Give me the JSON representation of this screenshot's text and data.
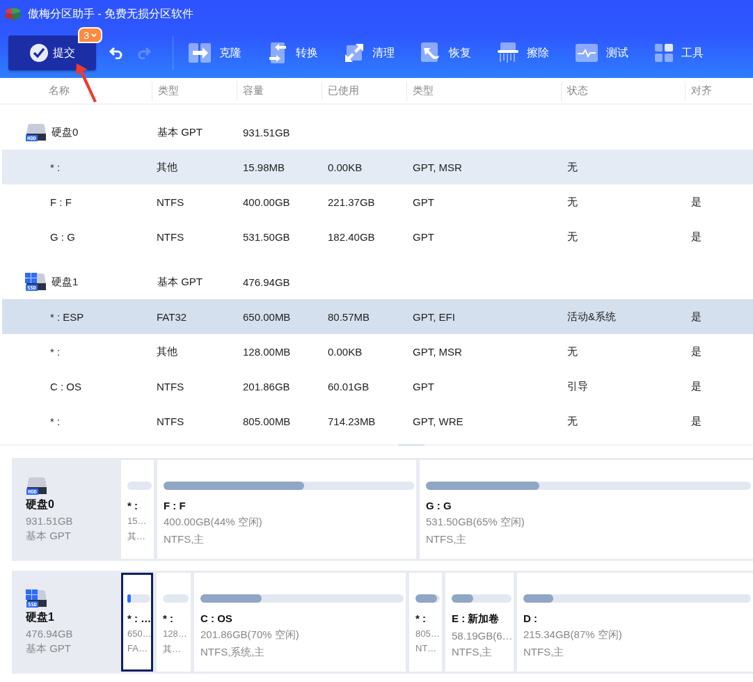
{
  "window": {
    "title": "傲梅分区助手 - 免费无损分区软件"
  },
  "toolbar": {
    "submit": {
      "label": "提交",
      "badge": "3"
    },
    "undo": {
      "disabled": false
    },
    "redo": {
      "disabled": true
    },
    "tools": [
      {
        "kind": "clone",
        "label": "克隆"
      },
      {
        "kind": "convert",
        "label": "转换"
      },
      {
        "kind": "clean",
        "label": "清理"
      },
      {
        "kind": "recover",
        "label": "恢复"
      },
      {
        "kind": "wipe",
        "label": "擦除"
      },
      {
        "kind": "test",
        "label": "测试"
      },
      {
        "kind": "tools",
        "label": "工具"
      }
    ]
  },
  "table": {
    "columns": [
      "名称",
      "类型",
      "容量",
      "已使用",
      "类型",
      "状态",
      "对齐"
    ],
    "disks": [
      {
        "name": "硬盘0",
        "kind": "hdd",
        "icon_label": "HDD",
        "type": "基本 GPT",
        "capacity": "931.51GB",
        "partitions": [
          {
            "name": "* :",
            "type": "其他",
            "capacity": "15.98MB",
            "used": "0.00KB",
            "type2": "GPT, MSR",
            "status": "无",
            "selected": false,
            "hovered": true
          },
          {
            "name": "F : F",
            "type": "NTFS",
            "capacity": "400.00GB",
            "used": "221.37GB",
            "type2": "GPT",
            "status": "无",
            "align": "是",
            "selected": false,
            "hovered": false
          },
          {
            "name": "G : G",
            "type": "NTFS",
            "capacity": "531.50GB",
            "used": "182.40GB",
            "type2": "GPT",
            "status": "无",
            "align": "是",
            "selected": false,
            "hovered": false
          }
        ]
      },
      {
        "name": "硬盘1",
        "kind": "ssd",
        "icon_label": "SSD",
        "type": "基本 GPT",
        "capacity": "476.94GB",
        "partitions": [
          {
            "name": "* : ESP",
            "type": "FAT32",
            "capacity": "650.00MB",
            "used": "80.57MB",
            "type2": "GPT, EFI",
            "status": "活动&系统",
            "align": "是",
            "selected": true,
            "hovered": false
          },
          {
            "name": "* :",
            "type": "其他",
            "capacity": "128.00MB",
            "used": "0.00KB",
            "type2": "GPT, MSR",
            "status": "无",
            "align": "是",
            "selected": false,
            "hovered": false
          },
          {
            "name": "C : OS",
            "type": "NTFS",
            "capacity": "201.86GB",
            "used": "60.01GB",
            "type2": "GPT",
            "status": "引导",
            "align": "是",
            "selected": false,
            "hovered": false
          },
          {
            "name": "* :",
            "type": "NTFS",
            "capacity": "805.00MB",
            "used": "714.23MB",
            "type2": "GPT, WRE",
            "status": "无",
            "align": "是",
            "selected": false,
            "hovered": false
          }
        ]
      }
    ]
  },
  "disk_map": [
    {
      "name": "硬盘0",
      "kind": "hdd",
      "icon_label": "HDD",
      "capacity": "931.51GB",
      "type": "基本 GPT",
      "partitions": [
        {
          "name": "* :",
          "size": "15…",
          "fs": "其…",
          "selected": false
        },
        {
          "name": "F : F",
          "size": "400.00GB(44% 空闲)",
          "fs": "NTFS,主",
          "level": 0.56,
          "selected": false
        },
        {
          "name": "G : G",
          "size": "531.50GB(65% 空闲)",
          "fs": "NTFS,主",
          "level": 0.35,
          "selected": false
        }
      ]
    },
    {
      "name": "硬盘1",
      "kind": "ssd",
      "icon_label": "SSD",
      "capacity": "476.94GB",
      "type": "基本 GPT",
      "partitions": [
        {
          "name": "* : …",
          "size": "650…",
          "fs": "FA…",
          "level": 0.12,
          "selected": true
        },
        {
          "name": "* :",
          "size": "128…",
          "fs": "其…",
          "selected": false
        },
        {
          "name": "C : OS",
          "size": "201.86GB(70% 空闲)",
          "fs": "NTFS,系统,主",
          "level": 0.3,
          "selected": false
        },
        {
          "name": "* :",
          "size": "805…",
          "fs": "NT…",
          "level": 0.89,
          "selected": false
        },
        {
          "name": "E : 新加卷",
          "size": "58.19GB(6…",
          "fs": "NTFS,主",
          "level": 0.36,
          "selected": false
        },
        {
          "name": "D :",
          "size": "215.34GB(87% 空闲)",
          "fs": "NTFS,主",
          "level": 0.13,
          "selected": false
        }
      ]
    }
  ]
}
